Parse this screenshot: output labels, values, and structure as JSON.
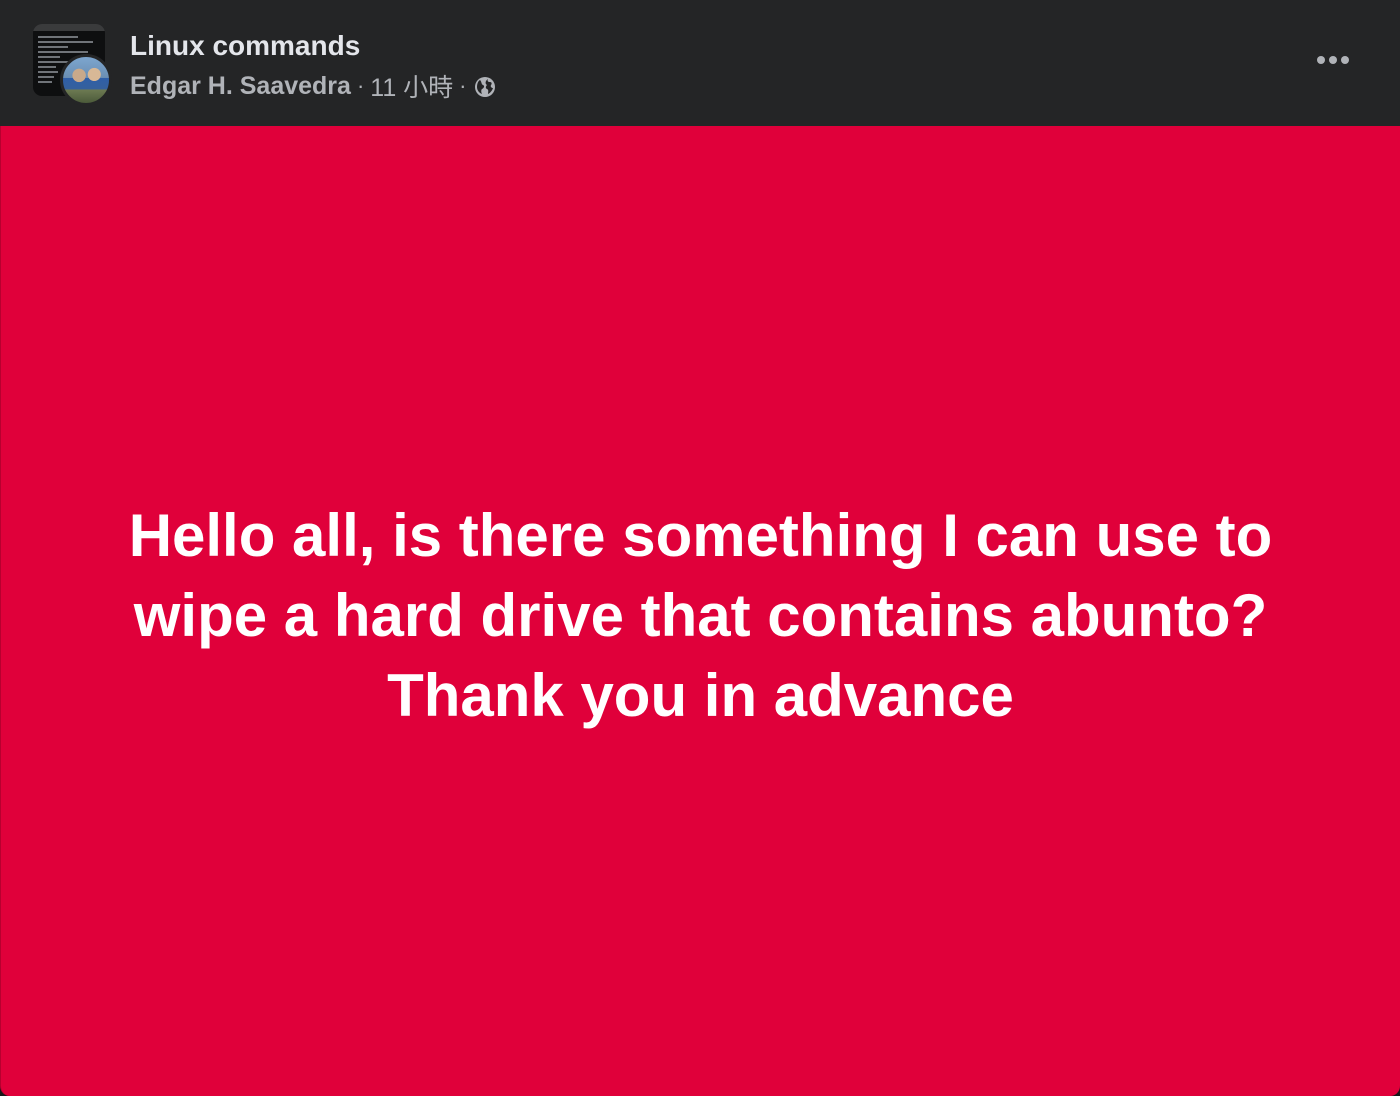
{
  "group": {
    "name": "Linux commands",
    "avatar_icon": "group-avatar-image",
    "member_avatar_icon": "user-avatar-image"
  },
  "post": {
    "author": "Edgar H. Saavedra",
    "separator": "·",
    "time": "11 小時",
    "privacy_icon": "globe-icon",
    "text_lines": [
      "Hello all, is there something I can use to",
      "wipe a hard drive that contains abunto?",
      "Thank you in advance"
    ],
    "background_color": "#E0003A",
    "text_color": "#FFFFFF"
  },
  "menu": {
    "icon": "more-horizontal-icon"
  },
  "colors": {
    "header_background": "#242526",
    "primary_text": "#E4E6EB",
    "secondary_text": "#B0B3B8"
  }
}
